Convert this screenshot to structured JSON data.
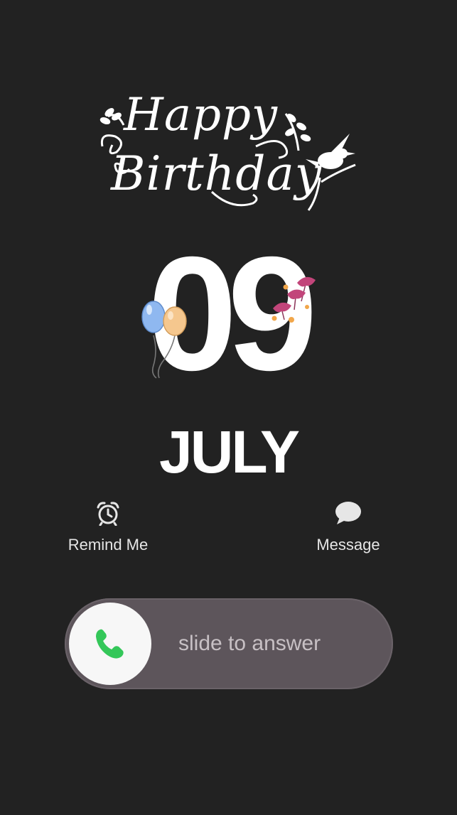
{
  "greeting": {
    "line1": "Happy",
    "line2": "Birthday"
  },
  "date": {
    "day": "09",
    "month": "JULY"
  },
  "decorations": {
    "balloon_colors": [
      "#8fb8f0",
      "#f5c78e"
    ],
    "flower_color": "#c2457a",
    "small_flower_color": "#f1a64a"
  },
  "actions": [
    {
      "label": "Remind Me",
      "icon": "alarm-clock-icon"
    },
    {
      "label": "Message",
      "icon": "message-bubble-icon"
    }
  ],
  "slider": {
    "text": "slide to answer",
    "knob_icon": "phone-icon",
    "accent_color": "#34c759"
  }
}
